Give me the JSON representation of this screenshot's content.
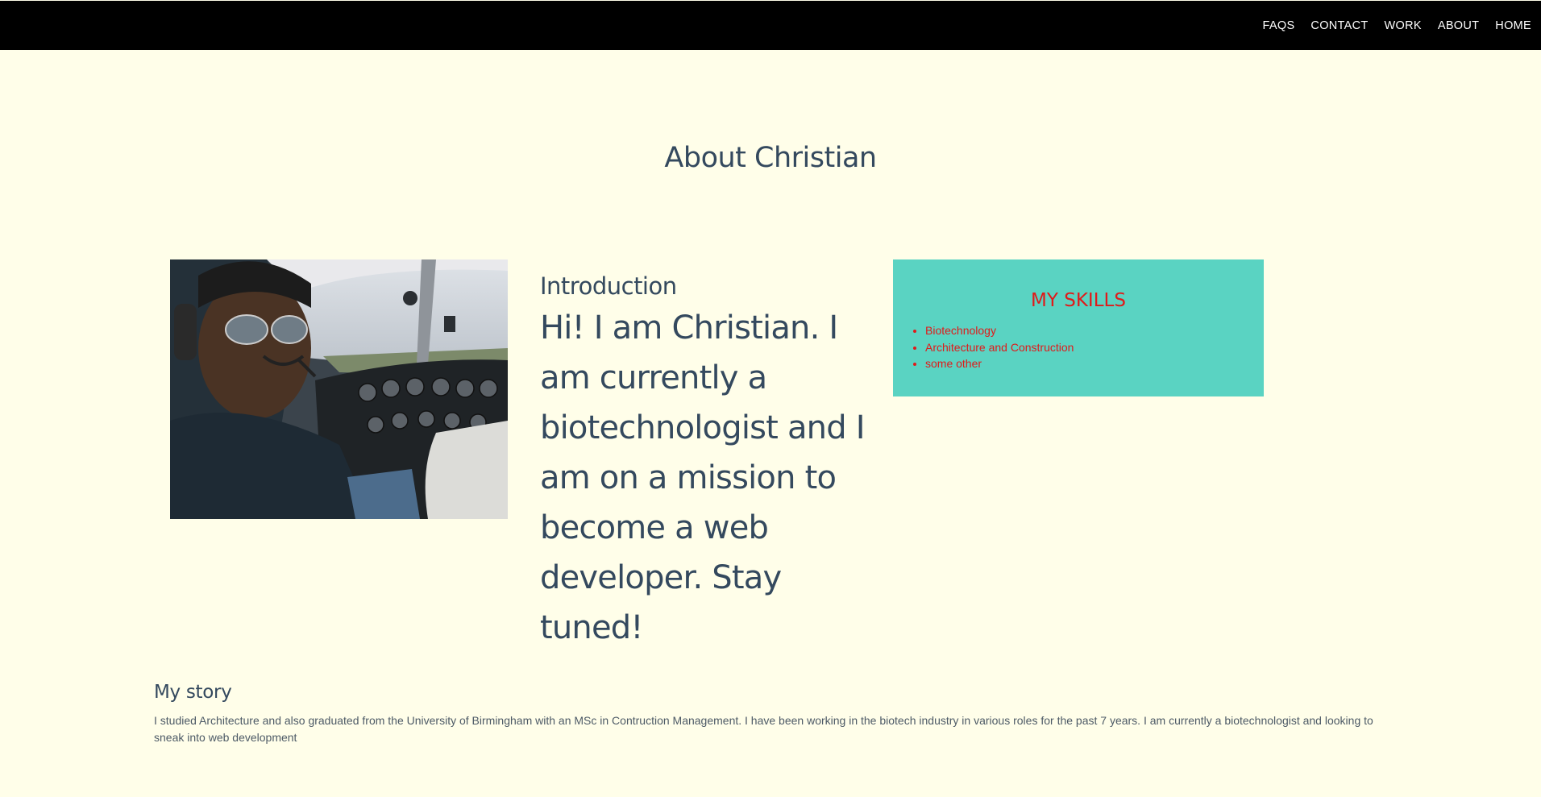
{
  "nav": {
    "items": [
      {
        "label": "HOME"
      },
      {
        "label": "ABOUT"
      },
      {
        "label": "WORK"
      },
      {
        "label": "CONTACT"
      },
      {
        "label": "FAQS"
      }
    ]
  },
  "page": {
    "title": "About Christian"
  },
  "intro": {
    "heading": "Introduction",
    "text": "Hi! I am Christian. I am currently a biotechnologist and I am on a mission to become a web developer. Stay tuned!"
  },
  "skills": {
    "title": "MY SKILLS",
    "items": [
      "Biotechnology",
      "Architecture and Construction",
      "some other"
    ]
  },
  "story": {
    "heading": "My story",
    "text": "I studied Architecture and also graduated from the University of Birmingham with an MSc in Contruction Management. I have been working in the biotech industry in various roles for the past 7 years. I am currently a biotechnologist and looking to sneak into web development"
  },
  "colors": {
    "background": "#fffee9",
    "navbar": "#000000",
    "heading_text": "#34495e",
    "skills_box": "#5ad3c2",
    "skills_text": "#e01a1a"
  }
}
